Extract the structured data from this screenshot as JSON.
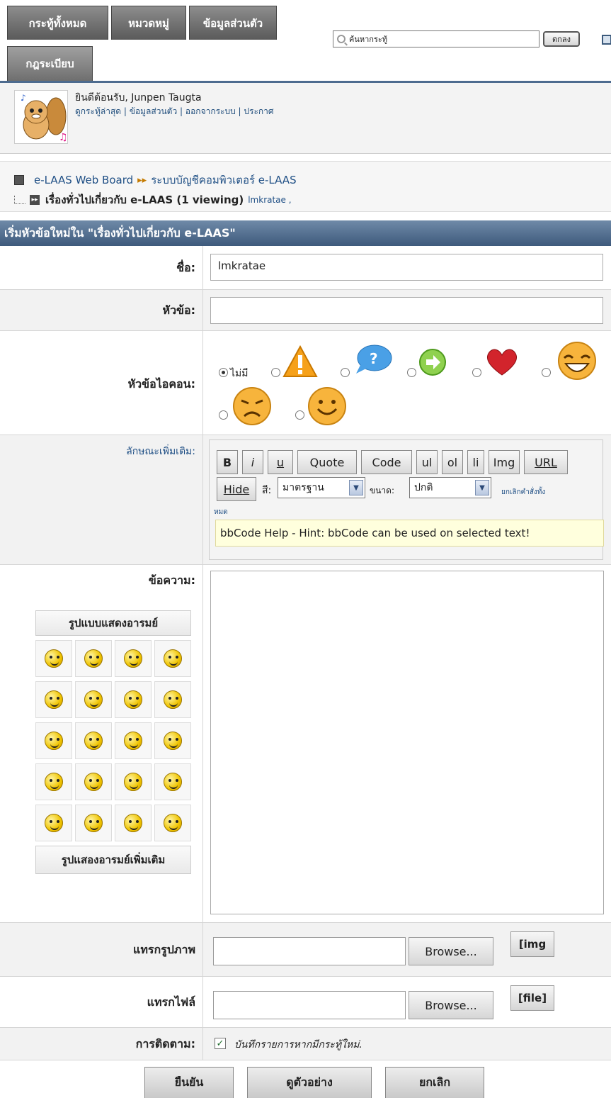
{
  "tabs": [
    {
      "label": "กระทู้ทั้งหมด"
    },
    {
      "label": "หมวดหมู่"
    },
    {
      "label": "ข้อมูลส่วนตัว"
    },
    {
      "label": "กฎระเบียบ"
    }
  ],
  "search": {
    "placeholder": "ค้นหากระทู้",
    "button": "ตกลง"
  },
  "welcome": {
    "greeting": "ยินดีต้อนรับ, Junpen Taugta",
    "links": "ดูกระทู้ล่าสุด | ข้อมูลส่วนตัว | ออกจากระบบ   | ประกาศ"
  },
  "breadcrumb": {
    "root": "e-LAAS Web Board",
    "arrows": "▸▸",
    "category": "ระบบบัญชีคอมพิวเตอร์ e-LAAS",
    "forum": "เรื่องทั่วไปเกี่ยวกับ e-LAAS (1 viewing)",
    "viewer": "lmkratae ,"
  },
  "section_title": "เริ่มหัวข้อใหม่ใน \"เรื่องทั่วไปเกี่ยวกับ e-LAAS\"",
  "form": {
    "name_label": "ชื่อ:",
    "name_value": "lmkratae",
    "subject_label": "หัวข้อ:",
    "subject_value": "",
    "icon_label": "หัวข้อไอคอน:",
    "icon_none": "ไม่มี",
    "extra_label": "ลักษณะเพิ่มเติม:",
    "message_label": "ข้อความ:",
    "image_label": "แทรกรูปภาพ",
    "file_label": "แทรกไฟล์",
    "follow_label": "การติดตาม:",
    "follow_text": "บันทึกรายการหากมีกระทู้ใหม่."
  },
  "bbcode": {
    "buttons": [
      "B",
      "i",
      "u",
      "Quote",
      "Code",
      "ul",
      "ol",
      "li",
      "Img",
      "URL"
    ],
    "hide": "Hide",
    "color_label": "สี:",
    "color_value": "มาตรฐาน",
    "size_label": "ขนาด:",
    "size_value": "ปกติ",
    "cancel_all": "ยกเลิกคำสั่งทั้ง",
    "cancel_all_2": "หมด",
    "hint": "bbCode Help - Hint: bbCode can be used on selected text!"
  },
  "emoticons": {
    "title": "รูปแบบแสดงอารมย์",
    "more": "รูปแสองอารมย์เพิ่มเติม"
  },
  "upload": {
    "browse": "Browse...",
    "img_tag": "[img",
    "file_tag": "[file]"
  },
  "buttons": {
    "submit": "ยืนยัน",
    "preview": "ดูตัวอย่าง",
    "cancel": "ยกเลิก"
  },
  "colors": {
    "header": "#4d6b8f",
    "link": "#1f4f85"
  }
}
